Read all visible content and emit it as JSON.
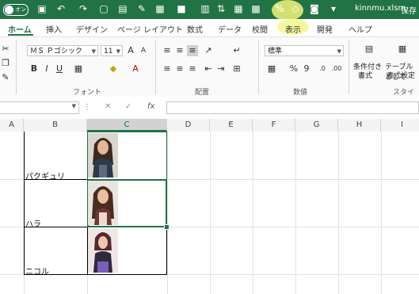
{
  "titlebar": {
    "autosave_label": "オン",
    "filename": "kinnmu.xlsm",
    "save_state": "保存"
  },
  "ribbon_tabs": [
    "ホーム",
    "挿入",
    "デザイン",
    "ページ レイアウト",
    "数式",
    "データ",
    "校閲",
    "表示",
    "開発",
    "ヘルプ"
  ],
  "font": {
    "name": "ＭＳ Ｐゴシック",
    "size": "11"
  },
  "number_format": "標準",
  "groups": {
    "font": "フォント",
    "alignment": "配置",
    "number": "数値",
    "styles": "スタイル"
  },
  "styles_buttons": {
    "conditional": "条件付き",
    "conditional2": "書式",
    "table": "テーブルとして",
    "table2": "書式設定"
  },
  "columns": [
    "A",
    "B",
    "C",
    "D",
    "E",
    "F",
    "G",
    "H",
    "I"
  ],
  "rows": [
    {
      "name": "パクギュリ"
    },
    {
      "name": "ハラ"
    },
    {
      "name": "ニコル"
    }
  ],
  "fx_label": "fx"
}
